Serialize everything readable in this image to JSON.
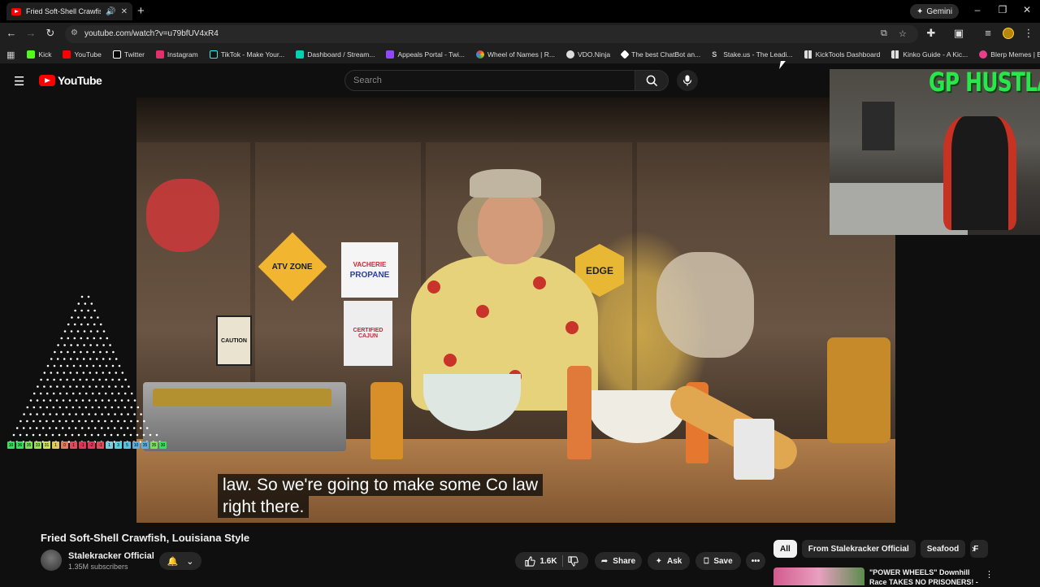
{
  "browser": {
    "tab_title": "Fried Soft-Shell Crawfish, Lo",
    "new_tab": "+",
    "gemini_label": "Gemini",
    "url": "youtube.com/watch?v=u79bfUV4xR4"
  },
  "bookmarks": [
    {
      "label": "Kick",
      "color": "#53fc18"
    },
    {
      "label": "YouTube",
      "color": "#ff0000"
    },
    {
      "label": "Twitter",
      "color": "#ffffff"
    },
    {
      "label": "Instagram",
      "color": "#e1306c"
    },
    {
      "label": "TikTok - Make Your...",
      "color": "#111111"
    },
    {
      "label": "Dashboard / Stream...",
      "color": "#00d1b2"
    },
    {
      "label": "Appeals Portal - Twi...",
      "color": "#9146ff"
    },
    {
      "label": "Wheel of Names | R...",
      "color": "#4285f4"
    },
    {
      "label": "VDO.Ninja",
      "color": "#dddddd"
    },
    {
      "label": "The best ChatBot an...",
      "color": "#ffffff"
    },
    {
      "label": "Stake.us - The Leadi...",
      "color": "#cccccc"
    },
    {
      "label": "KickTools Dashboard",
      "color": "#dddddd"
    },
    {
      "label": "Kinko Guide - A Kic...",
      "color": "#dddddd"
    },
    {
      "label": "Blerp Memes | Best...",
      "color": "#e83e8c"
    }
  ],
  "youtube": {
    "logo_text": "YouTube",
    "search_placeholder": "Search"
  },
  "video": {
    "caption_line1": "law. So we're going to make some Co law",
    "caption_line2": "right there.",
    "sign_atv": "ATV ZONE",
    "sign_vacherie": "VACHERIE",
    "sign_propane": "PROPANE",
    "sign_caution": "CAUTION",
    "sign_cajun": "CERTIFIED CAJUN",
    "sign_edge": "EDGE"
  },
  "overlay": {
    "webcam_text": "GP HUSTLA",
    "viz_labels": [
      "10",
      "36",
      "35",
      "33",
      "31",
      "1",
      "0",
      "1",
      "-1",
      "-2",
      "-1",
      "1",
      "3",
      "5",
      "10",
      "35",
      "35",
      "30"
    ]
  },
  "watch": {
    "title": "Fried Soft-Shell Crawfish, Louisiana Style",
    "channel_name": "Stalekracker Official",
    "subscribers": "1.35M subscribers",
    "likes": "1.6K",
    "share": "Share",
    "ask": "Ask",
    "save": "Save"
  },
  "chips": [
    "All",
    "From Stalekracker Official",
    "Seafood",
    "F"
  ],
  "recommendation": {
    "title": "\"POWER WHEELS\" Downhill Race TAKES NO PRISONERS! -"
  }
}
